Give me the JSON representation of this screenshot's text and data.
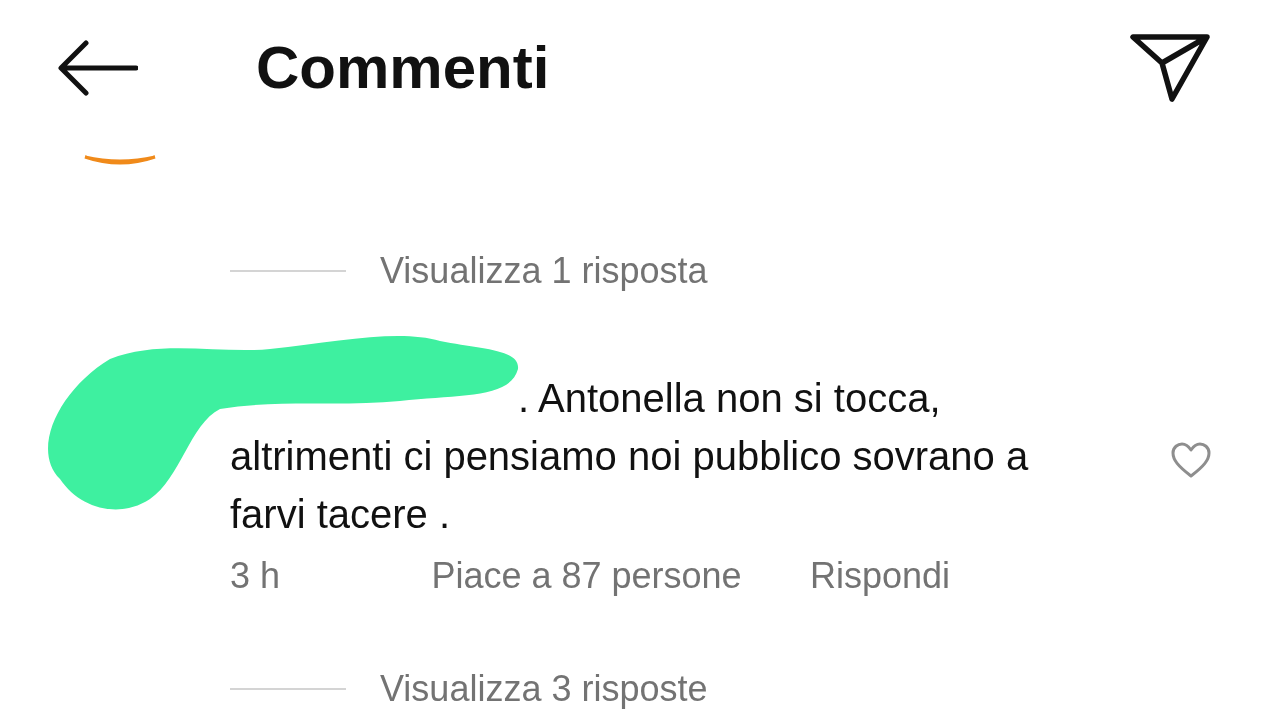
{
  "header": {
    "title": "Commenti"
  },
  "threads": [
    {
      "kind": "replies",
      "label": "Visualizza 1 risposta"
    },
    {
      "kind": "comment",
      "text": ". Antonella non si tocca, altrimenti ci pensiamo noi pubblico sovrano a farvi tacere .",
      "time": "3 h",
      "likes": "Piace a 87 persone",
      "reply": "Rispondi",
      "liked": false
    },
    {
      "kind": "replies",
      "label": "Visualizza 3 risposte"
    }
  ]
}
